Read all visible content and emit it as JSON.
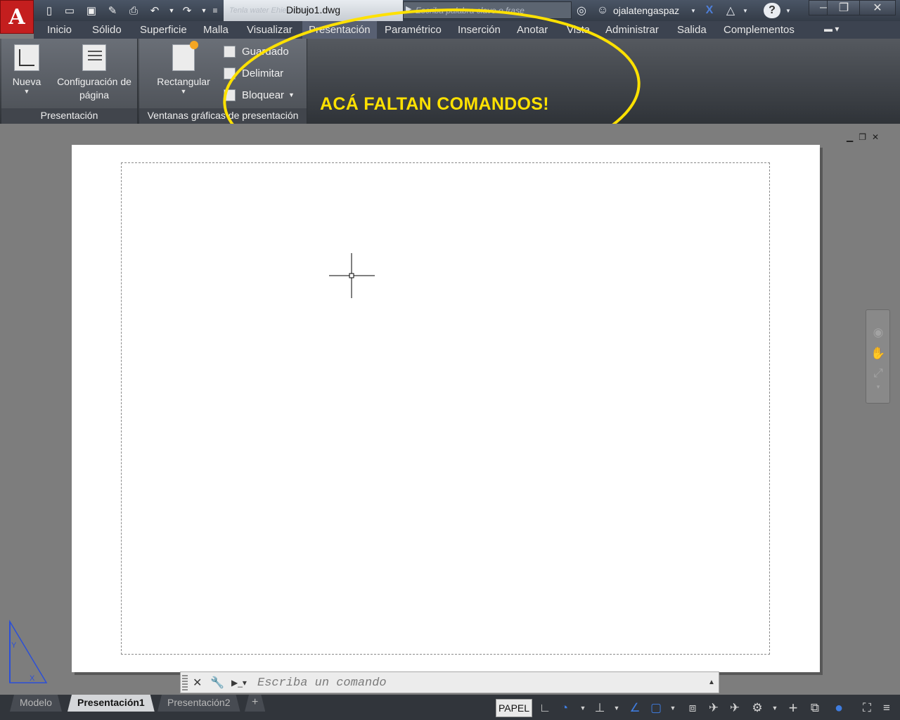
{
  "title_bar": {
    "document_title": "Dibujo1.dwg",
    "ghost_text": "Tenla water  Ehie uf  Colo",
    "search_placeholder": "Escriba palabra clave o frase",
    "user_name": "ojalatengaspaz"
  },
  "ribbon_tabs": [
    {
      "label": "Inicio"
    },
    {
      "label": "Sólido"
    },
    {
      "label": "Superficie"
    },
    {
      "label": "Malla"
    },
    {
      "label": "Visualizar"
    },
    {
      "label": "Presentación"
    },
    {
      "label": "Paramétrico"
    },
    {
      "label": "Inserción"
    },
    {
      "label": "Anotar"
    },
    {
      "label": "Vista"
    },
    {
      "label": "Administrar"
    },
    {
      "label": "Salida"
    },
    {
      "label": "Complementos"
    }
  ],
  "active_tab": "Presentación",
  "panels": {
    "presentacion": {
      "title": "Presentación",
      "nueva_label": "Nueva",
      "config_label_line1": "Configuración de",
      "config_label_line2": "página"
    },
    "ventanas": {
      "title": "Ventanas gráficas de presentación",
      "rectangular_label": "Rectangular",
      "guardado_label": "Guardado",
      "delimitar_label": "Delimitar",
      "bloquear_label": "Bloquear"
    }
  },
  "annotation": {
    "text": "ACÁ FALTAN COMANDOS!",
    "color": "#ffe100"
  },
  "command_line": {
    "placeholder": "Escriba un comando"
  },
  "layout_tabs": [
    {
      "label": "Modelo"
    },
    {
      "label": "Presentación1"
    },
    {
      "label": "Presentación2"
    }
  ],
  "active_layout": "Presentación1",
  "status": {
    "space_label": "PAPEL"
  },
  "colors": {
    "app_button": "#c41e1e",
    "annotation_yellow": "#ffe100",
    "toggle_blue": "#3f7de0"
  }
}
